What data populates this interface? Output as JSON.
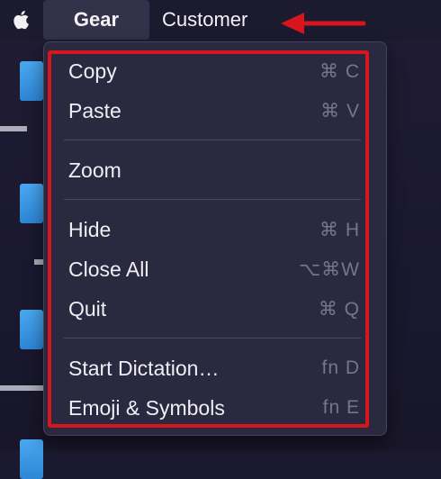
{
  "menubar": {
    "apple_icon": "apple-logo-icon",
    "app_name": "Gear",
    "menu_title": "Customer"
  },
  "menu": {
    "groups": [
      [
        {
          "label": "Copy",
          "shortcut": "⌘ C"
        },
        {
          "label": "Paste",
          "shortcut": "⌘ V"
        }
      ],
      [
        {
          "label": "Zoom",
          "shortcut": ""
        }
      ],
      [
        {
          "label": "Hide",
          "shortcut": "⌘ H"
        },
        {
          "label": "Close All",
          "shortcut": "⌥⌘W"
        },
        {
          "label": "Quit",
          "shortcut": "⌘ Q"
        }
      ],
      [
        {
          "label": "Start Dictation…",
          "shortcut": "fn D"
        },
        {
          "label": "Emoji & Symbols",
          "shortcut": "fn E"
        }
      ]
    ]
  },
  "annotation": {
    "color": "#d8141c"
  }
}
